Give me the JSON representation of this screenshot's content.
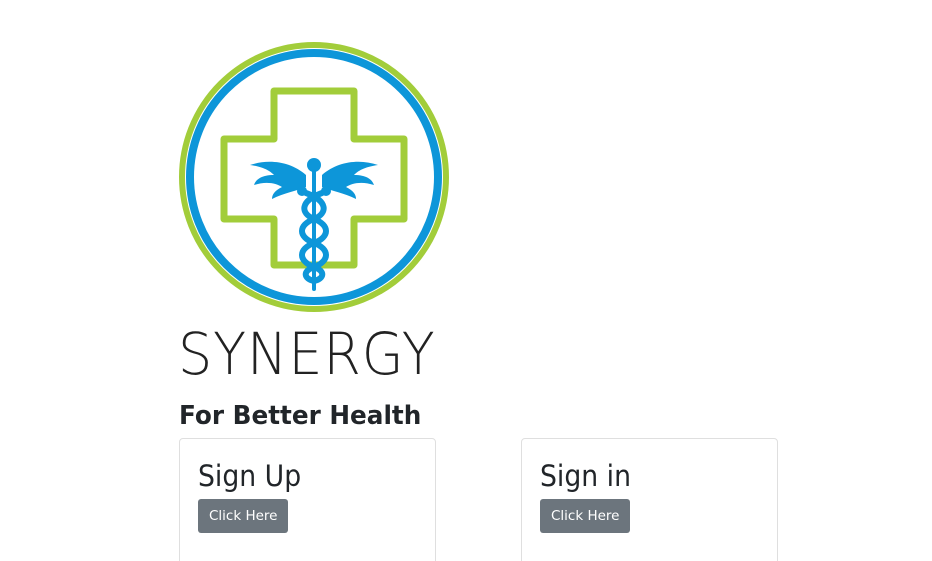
{
  "brand": {
    "name": "SYNERGY",
    "tagline": "For Better Health",
    "colors": {
      "green": "#a2cd3a",
      "blue": "#0d96d9"
    }
  },
  "cards": {
    "signup": {
      "title": "Sign Up",
      "button_label": "Click Here"
    },
    "signin": {
      "title": "Sign in",
      "button_label": "Click Here"
    }
  },
  "colors": {
    "button_bg": "#6c757d",
    "text": "#212529",
    "card_border": "#dfdfdf"
  }
}
